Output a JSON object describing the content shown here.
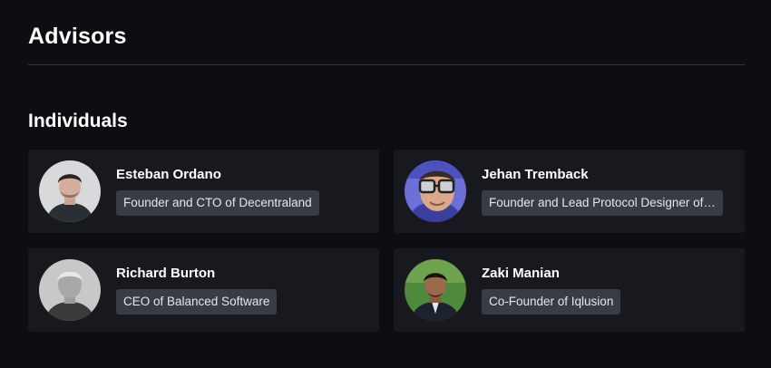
{
  "page": {
    "title": "Advisors",
    "section_title": "Individuals"
  },
  "advisors": [
    {
      "name": "Esteban Ordano",
      "role": "Founder and CTO of Decentraland",
      "avatar_icon": "person-photo-icon"
    },
    {
      "name": "Jehan Tremback",
      "role": "Founder and Lead Protocol Designer of…",
      "avatar_icon": "person-photo-icon"
    },
    {
      "name": "Richard Burton",
      "role": "CEO of Balanced Software",
      "avatar_icon": "person-photo-icon"
    },
    {
      "name": "Zaki Manian",
      "role": "Co-Founder of Iqlusion",
      "avatar_icon": "person-photo-icon"
    }
  ],
  "colors": {
    "background": "#0d0e11",
    "card": "#17191e",
    "role_badge": "#383c45",
    "divider": "#2c3a39"
  }
}
